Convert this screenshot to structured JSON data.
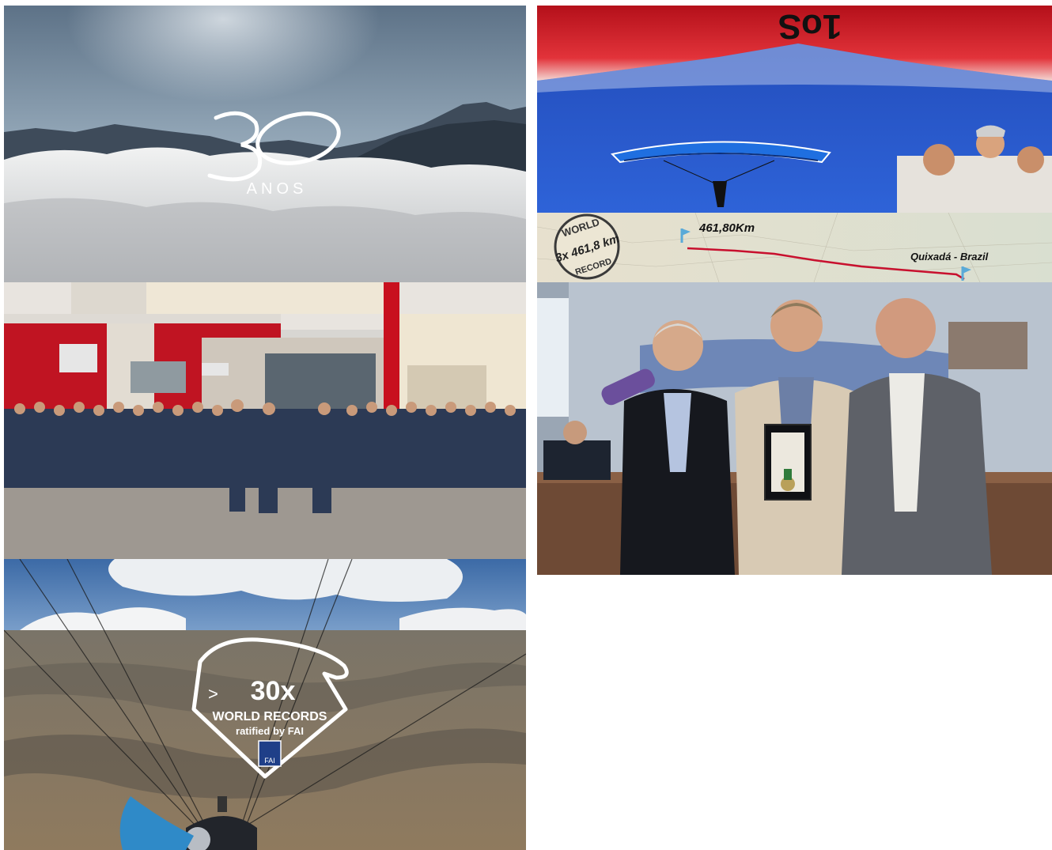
{
  "tiles": {
    "anniversary": {
      "number": "30",
      "word": "ANOS"
    },
    "record_flight": {
      "wing_brand": "1oS",
      "stamp_top": "WORLD",
      "stamp_middle": "3x 461,8 km",
      "stamp_bottom": "RECORD",
      "distance_label": "461,80Km",
      "location_label": "Quixadá - Brazil",
      "route_color": "#c8102e"
    },
    "team_photo": {},
    "award_ceremony": {},
    "world_records": {
      "prefix": ">",
      "count": "30x",
      "headline": "WORLD RECORDS",
      "subline": "ratified by FAI",
      "fai_badge": "FAI"
    }
  },
  "colors": {
    "brand_red": "#d0141c",
    "sky_blue": "#1f4fbf"
  }
}
